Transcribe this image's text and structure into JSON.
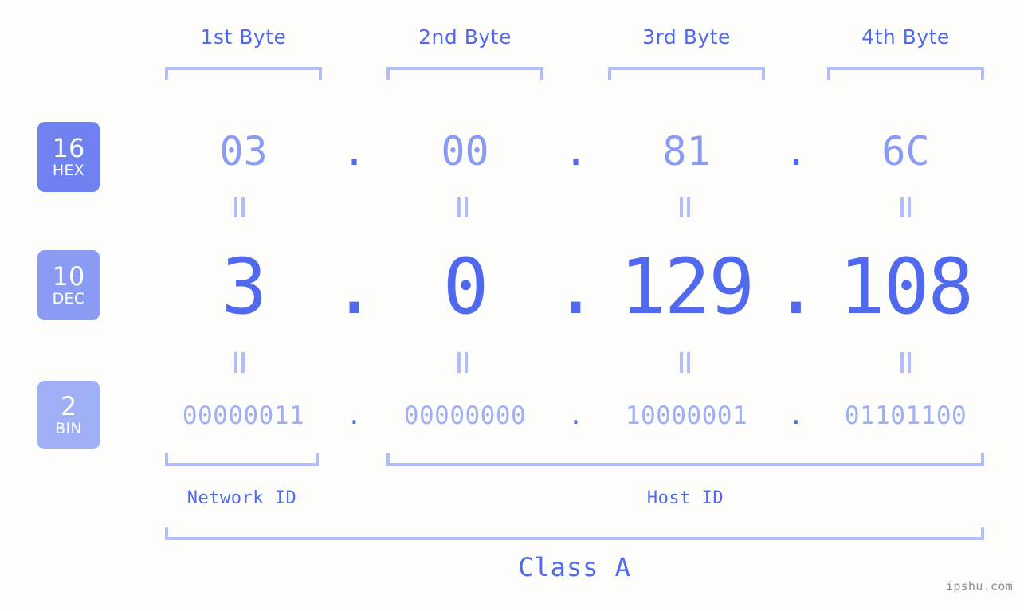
{
  "watermark": "ipshu.com",
  "byte_headers": [
    {
      "label": "1st Byte"
    },
    {
      "label": "2nd Byte"
    },
    {
      "label": "3rd Byte"
    },
    {
      "label": "4th Byte"
    }
  ],
  "radix_badges": [
    {
      "num": "16",
      "unit": "HEX",
      "color": "#6f82ef"
    },
    {
      "num": "10",
      "unit": "DEC",
      "color": "#8b9af3"
    },
    {
      "num": "2",
      "unit": "BIN",
      "color": "#9fb0f7"
    }
  ],
  "rows": {
    "hex": {
      "octets": [
        "03",
        "00",
        "81",
        "6C"
      ],
      "separator": "."
    },
    "dec": {
      "octets": [
        "3",
        "0",
        "129",
        "108"
      ],
      "separator": "."
    },
    "bin": {
      "octets": [
        "00000011",
        "00000000",
        "10000001",
        "01101100"
      ],
      "separator": "."
    }
  },
  "equality_marks": {
    "symbol": "=",
    "count_per_row": 4,
    "rows": 2
  },
  "segments": {
    "network_id": "Network ID",
    "host_id": "Host ID",
    "class": "Class A"
  },
  "colors": {
    "background": "#fdfefb",
    "accent_strong": "#5069ee",
    "accent_mid": "#8b9af3",
    "accent_light": "#9fb0f7",
    "bracket": "#b3bdfb",
    "badge_hex": "#6f82ef",
    "badge_dec": "#8b9af3",
    "badge_bin": "#9fb0f7",
    "watermark": "#8a8a8a"
  }
}
